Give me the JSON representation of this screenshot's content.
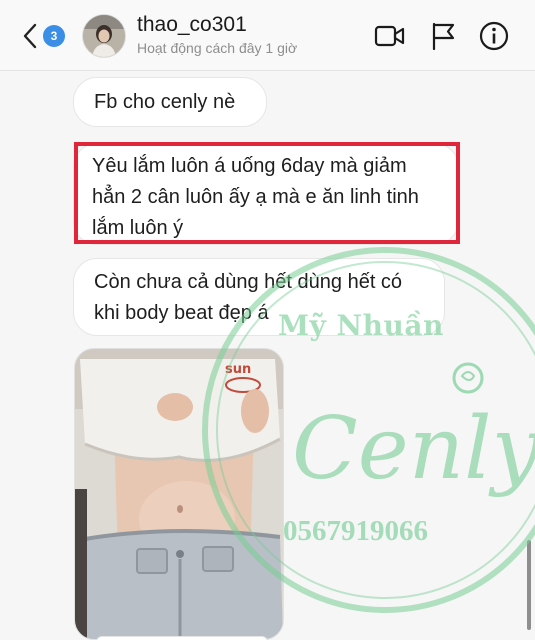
{
  "header": {
    "unread_count": "3",
    "contact_name": "thao_co301",
    "status": "Hoạt động cách đây 1 giờ"
  },
  "messages": [
    {
      "text": "Fb cho cenly nè"
    },
    {
      "text": "Yêu lắm luôn á uống 6day mà giảm hẳn 2 cân luôn ấy ạ mà e ăn linh tinh lắm luôn ý"
    },
    {
      "text": "Còn chưa cả dùng hết dùng hết có khi body beat đẹp á"
    }
  ],
  "photo_message": {
    "shirt_print": "sun"
  },
  "watermark": {
    "name": "Mỹ Nhuần",
    "script": "Cenly",
    "phone": "0567919066",
    "color": "#78cd96"
  },
  "colors": {
    "highlight": "#e0263b",
    "badge": "#3a8ee6"
  }
}
